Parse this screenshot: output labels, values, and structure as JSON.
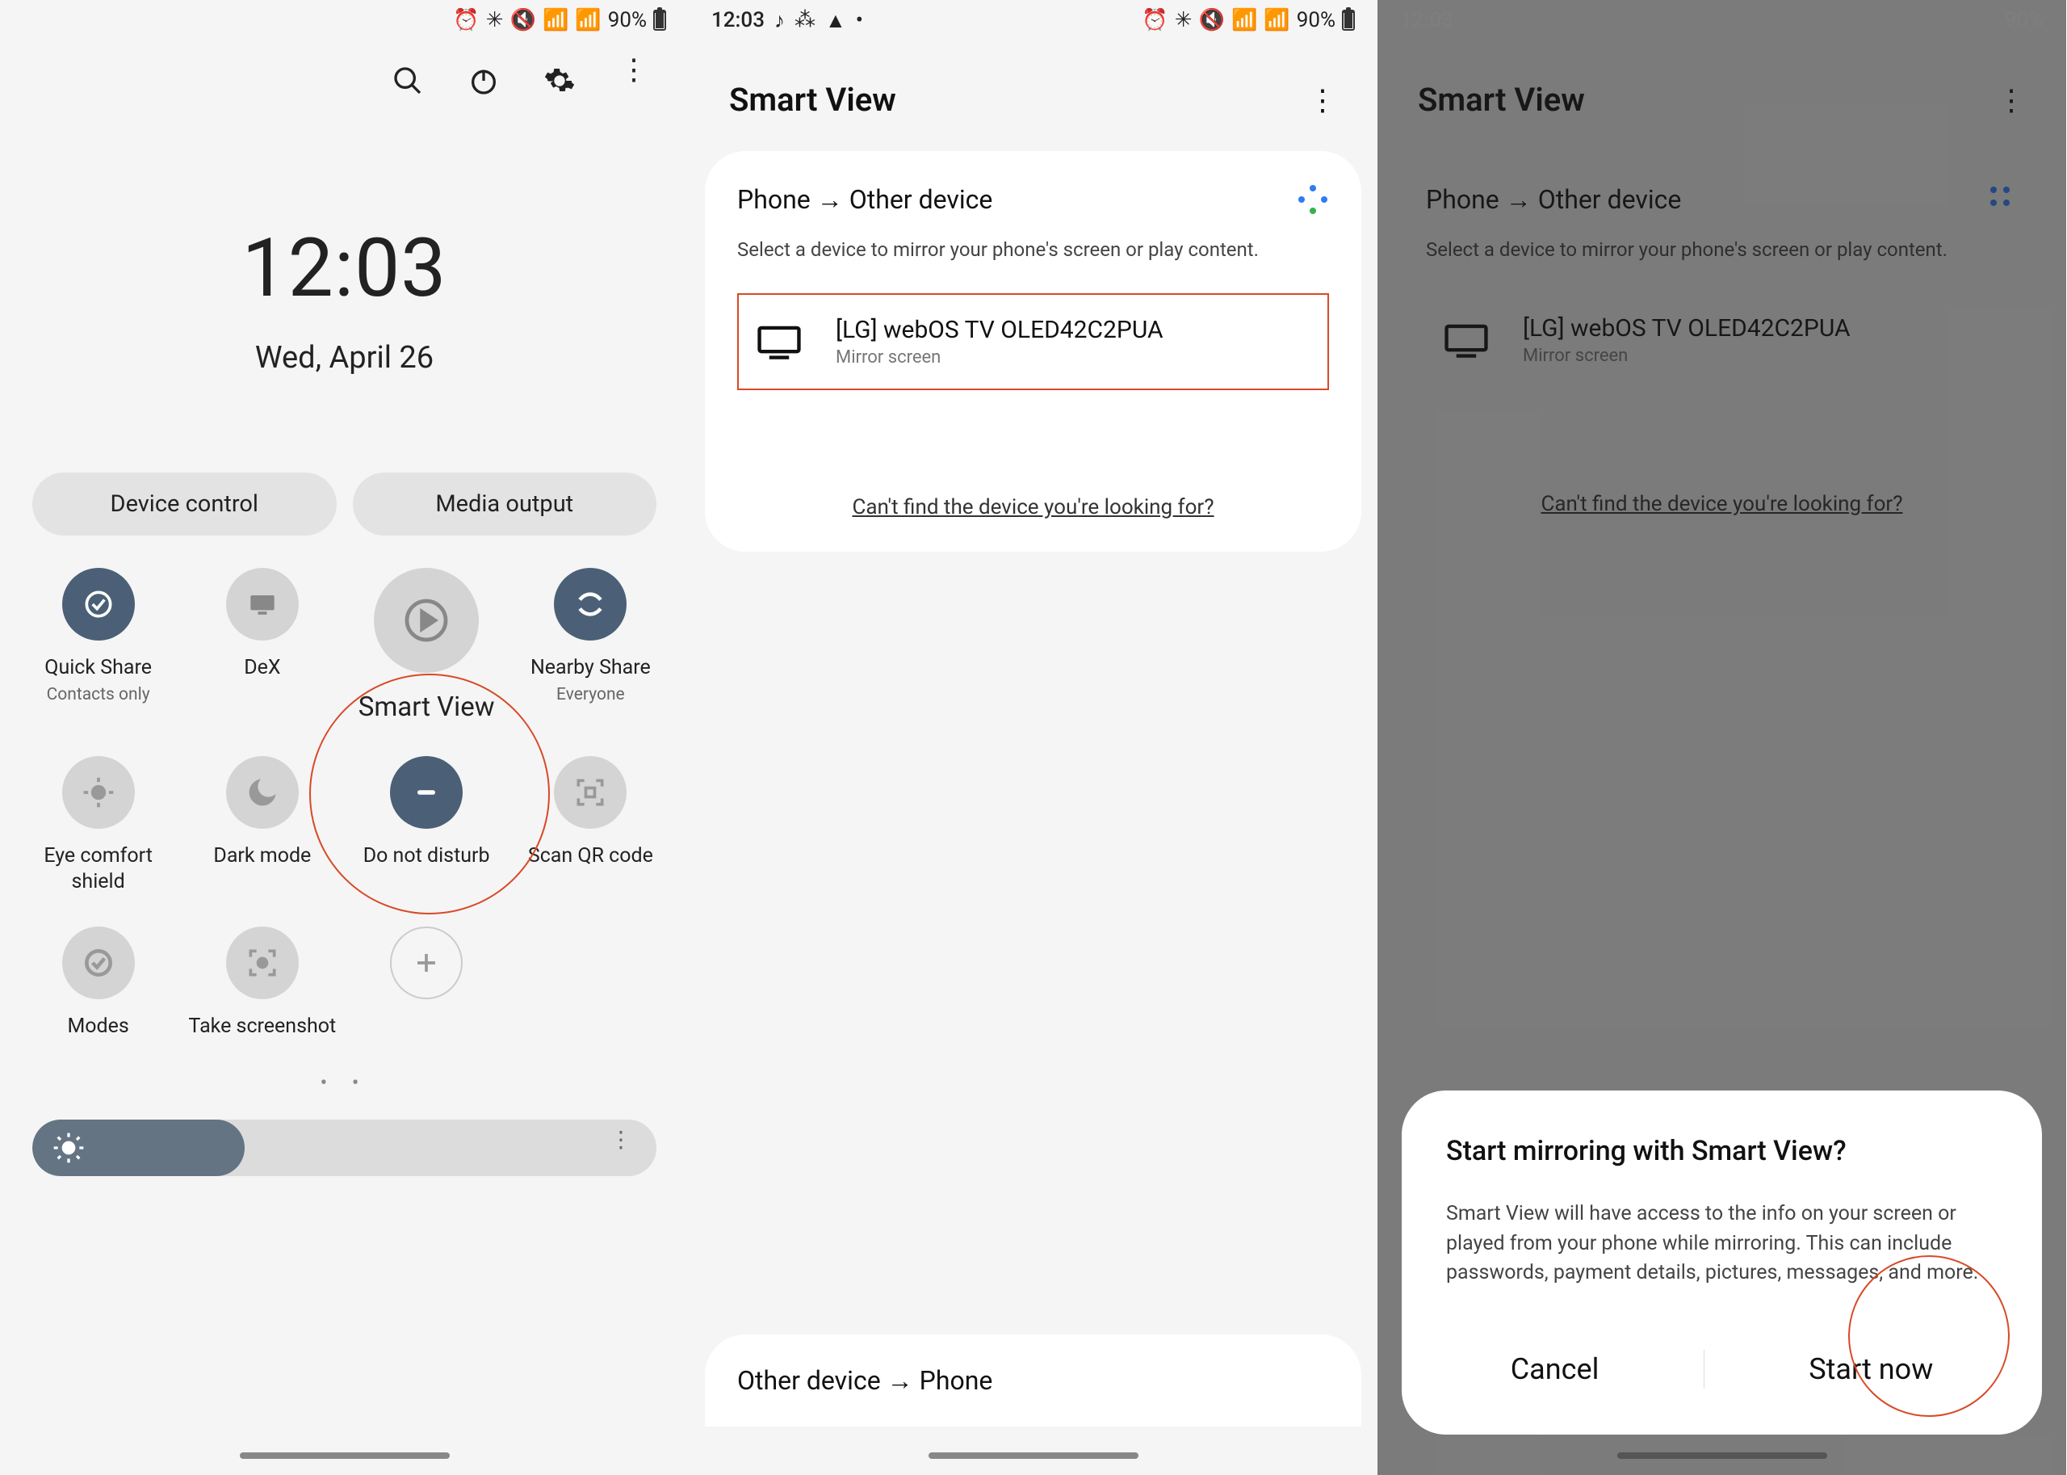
{
  "status": {
    "time": "12:03",
    "battery": "90%"
  },
  "screen1": {
    "time": "12:03",
    "date": "Wed, April 26",
    "pills": {
      "device_control": "Device control",
      "media_output": "Media output"
    },
    "tiles": {
      "quick_share": {
        "label": "Quick Share",
        "sub": "Contacts only"
      },
      "dex": {
        "label": "DeX"
      },
      "smart_view": {
        "label": "Smart View"
      },
      "nearby_share": {
        "label": "Nearby Share",
        "sub": "Everyone"
      },
      "eye_comfort": {
        "label": "Eye comfort shield"
      },
      "dark_mode": {
        "label": "Dark mode"
      },
      "dnd": {
        "label": "Do not disturb"
      },
      "scan_qr": {
        "label": "Scan QR code"
      },
      "modes": {
        "label": "Modes"
      },
      "screenshot": {
        "label": "Take screenshot"
      }
    }
  },
  "smartview": {
    "title": "Smart View",
    "direction_phone": "Phone",
    "direction_other": "Other device",
    "instruction": "Select a device to mirror your phone's screen or play content.",
    "device_name": "[LG] webOS TV OLED42C2PUA",
    "device_sub": "Mirror screen",
    "help": "Can't find the device you're looking for?",
    "reverse_other": "Other device",
    "reverse_phone": "Phone"
  },
  "dialog": {
    "title": "Start mirroring with Smart View?",
    "body": "Smart View will have access to the info on your screen or played from your phone while mirroring. This can include passwords, payment details, pictures, messages, and more.",
    "cancel": "Cancel",
    "start": "Start now"
  }
}
